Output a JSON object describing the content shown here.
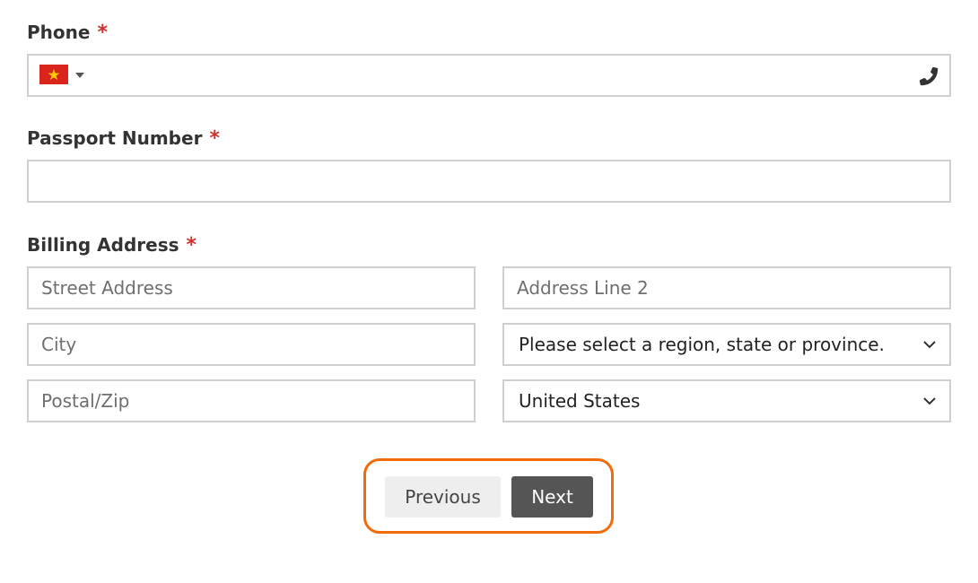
{
  "phone": {
    "label": "Phone",
    "required_mark": "*",
    "value": "",
    "country_flag": "vietnam-flag",
    "icon": "phone-icon"
  },
  "passport": {
    "label": "Passport Number",
    "required_mark": "*",
    "value": ""
  },
  "billing": {
    "label": "Billing Address",
    "required_mark": "*",
    "street_placeholder": "Street Address",
    "line2_placeholder": "Address Line 2",
    "city_placeholder": "City",
    "region_value": "Please select a region, state or province.",
    "postal_placeholder": "Postal/Zip",
    "country_value": "United States"
  },
  "buttons": {
    "previous": "Previous",
    "next": "Next"
  },
  "colors": {
    "required": "#d0312d",
    "highlight": "#f26b0a",
    "next_bg": "#555555",
    "prev_bg": "#eeeeee",
    "border": "#cfcfcf"
  }
}
